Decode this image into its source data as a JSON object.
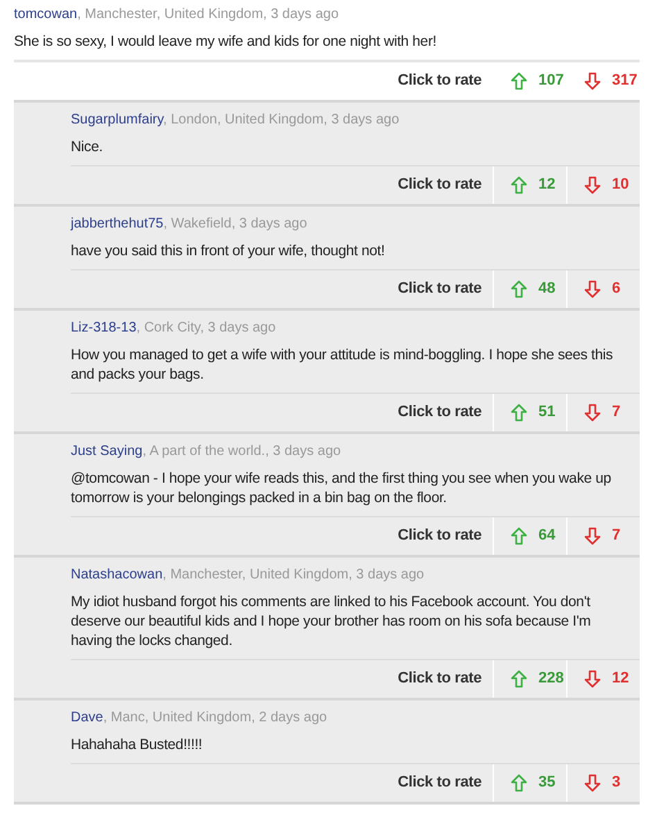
{
  "comments": [
    {
      "kind": "top",
      "author": "tomcowan",
      "meta": ", Manchester, United Kingdom, 3 days ago",
      "text": "She is so sexy, I would leave my wife and kids for one night with her!",
      "rate_label": "Click to rate",
      "up": "107",
      "down": "317"
    },
    {
      "kind": "reply",
      "author": "Sugarplumfairy",
      "meta": ", London, United Kingdom, 3 days ago",
      "text": "Nice.",
      "rate_label": "Click to rate",
      "up": "12",
      "down": "10"
    },
    {
      "kind": "reply",
      "author": "jabberthehut75",
      "meta": ", Wakefield, 3 days ago",
      "text": "have you said this in front of your wife, thought not!",
      "rate_label": "Click to rate",
      "up": "48",
      "down": "6"
    },
    {
      "kind": "reply",
      "author": "Liz-318-13",
      "meta": ", Cork City, 3 days ago",
      "text": "How you managed to get a wife with your attitude is mind-boggling. I hope she sees this and packs your bags.",
      "rate_label": "Click to rate",
      "up": "51",
      "down": "7"
    },
    {
      "kind": "reply",
      "author": "Just Saying",
      "meta": ", A part of the world., 3 days ago",
      "text": "@tomcowan - I hope your wife reads this, and the first thing you see when you wake up tomorrow is your belongings packed in a bin bag on the floor.",
      "rate_label": "Click to rate",
      "up": "64",
      "down": "7"
    },
    {
      "kind": "reply",
      "author": "Natashacowan",
      "meta": ", Manchester, United Kingdom, 3 days ago",
      "text": "My idiot husband forgot his comments are linked to his Facebook account. You don't deserve our beautiful kids and I hope your brother has room on his sofa because I'm having the locks changed.",
      "rate_label": "Click to rate",
      "up": "228",
      "down": "12"
    },
    {
      "kind": "reply",
      "author": "Dave",
      "meta": ", Manc, United Kingdom, 2 days ago",
      "text": "Hahahaha Busted!!!!!",
      "rate_label": "Click to rate",
      "up": "35",
      "down": "3"
    }
  ]
}
